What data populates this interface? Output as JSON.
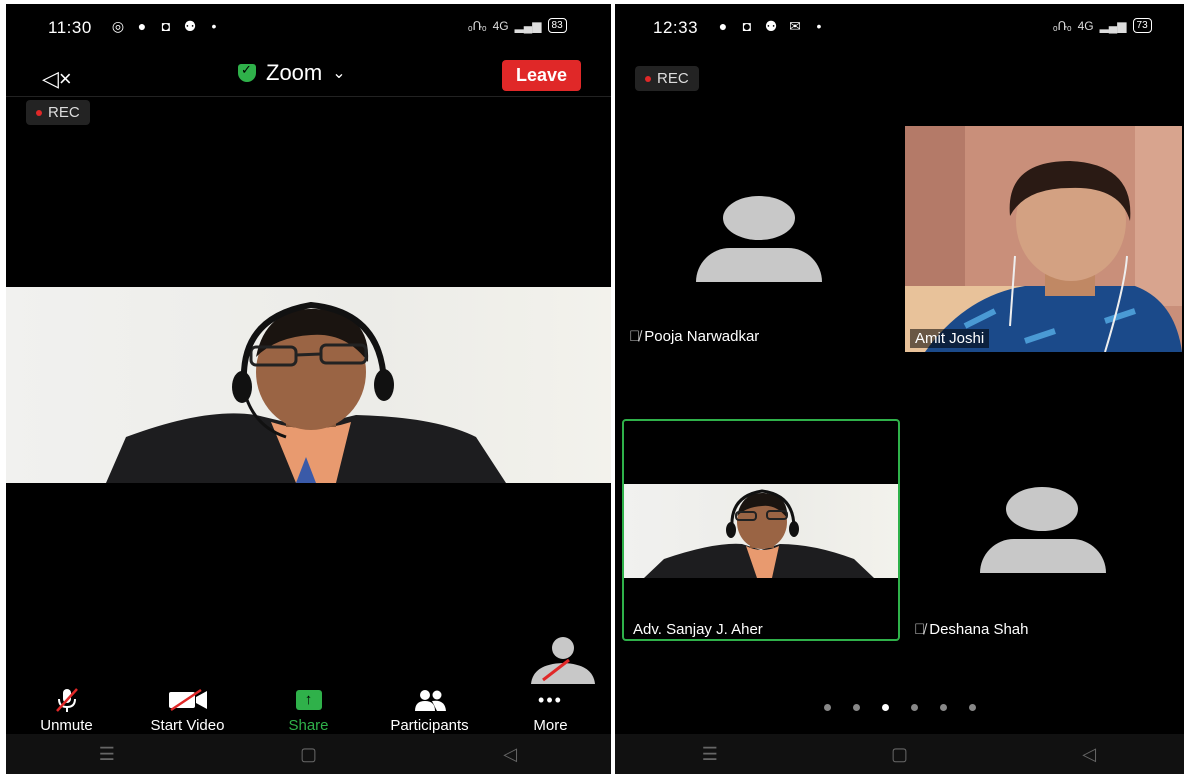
{
  "left": {
    "status": {
      "time": "11:30",
      "battery": "83",
      "network": "4G"
    },
    "header": {
      "title": "Zoom",
      "leave_label": "Leave"
    },
    "rec_label": "REC",
    "toolbar": {
      "unmute": "Unmute",
      "start_video": "Start Video",
      "share": "Share",
      "participants": "Participants",
      "more": "More"
    }
  },
  "right": {
    "status": {
      "time": "12:33",
      "battery": "73",
      "network": "4G"
    },
    "rec_label": "REC",
    "participants": [
      {
        "name": "Pooja Narwadkar",
        "muted": true,
        "video": false
      },
      {
        "name": "Amit Joshi",
        "muted": false,
        "video": true
      },
      {
        "name": "Adv. Sanjay J. Aher",
        "muted": false,
        "video": true,
        "active_speaker": true
      },
      {
        "name": "Deshana Shah",
        "muted": true,
        "video": false
      }
    ],
    "page_count": 6,
    "current_page": 3
  },
  "colors": {
    "accent_green": "#2fb14a",
    "leave_red": "#e02828",
    "rec_dot": "#e02828",
    "background": "#000000"
  }
}
